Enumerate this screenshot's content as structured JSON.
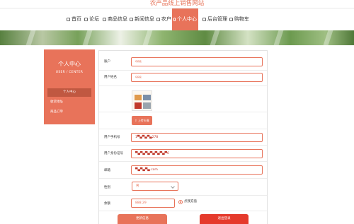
{
  "site": {
    "title": "农产品线上销售网站"
  },
  "nav": {
    "items": [
      {
        "label": "首页",
        "icon": "home-icon"
      },
      {
        "label": "论坛",
        "icon": "forum-icon"
      },
      {
        "label": "商品信息",
        "icon": "goods-icon"
      },
      {
        "label": "新闻信息",
        "icon": "news-icon"
      },
      {
        "label": "农户",
        "icon": "farmer-icon"
      },
      {
        "label": "个人中心",
        "icon": "user-icon",
        "active": true
      },
      {
        "label": "后台管理",
        "icon": "admin-icon"
      },
      {
        "label": "购物车",
        "icon": "cart-icon"
      }
    ],
    "active_color": "#e8735a"
  },
  "banner": {
    "slides": 3,
    "active_slide": 2
  },
  "sidebar": {
    "title": "个人中心",
    "subtitle": "USER / CENTER",
    "items": [
      {
        "label": "个人中心",
        "active": true
      },
      {
        "label": "收货地址"
      },
      {
        "label": "商品订单"
      }
    ]
  },
  "form": {
    "fields": {
      "account": {
        "label": "账户",
        "value": "qqq"
      },
      "name": {
        "label": "用户姓名",
        "value": "qqq"
      },
      "phone": {
        "label": "用户手机号",
        "value": "1▀▄▀▄▀▄278"
      },
      "idcard": {
        "label": "用户身份证号",
        "value": "▀▄▀▄▀▄▀▄▀▄▀▄▀6"
      },
      "email": {
        "label": "邮箱",
        "value": "▀▄▀▄▀▄.com"
      },
      "gender": {
        "label": "性别",
        "value": "男"
      },
      "balance": {
        "label": "余额",
        "value": "888.29"
      }
    },
    "upload_label": "上传头像",
    "charge_label": "点我充值",
    "update_button": "更新信息",
    "logout_button": "退出登录"
  },
  "colors": {
    "accent": "#e8735a",
    "danger": "#e53a2c",
    "sidebar_active": "#c05841"
  }
}
